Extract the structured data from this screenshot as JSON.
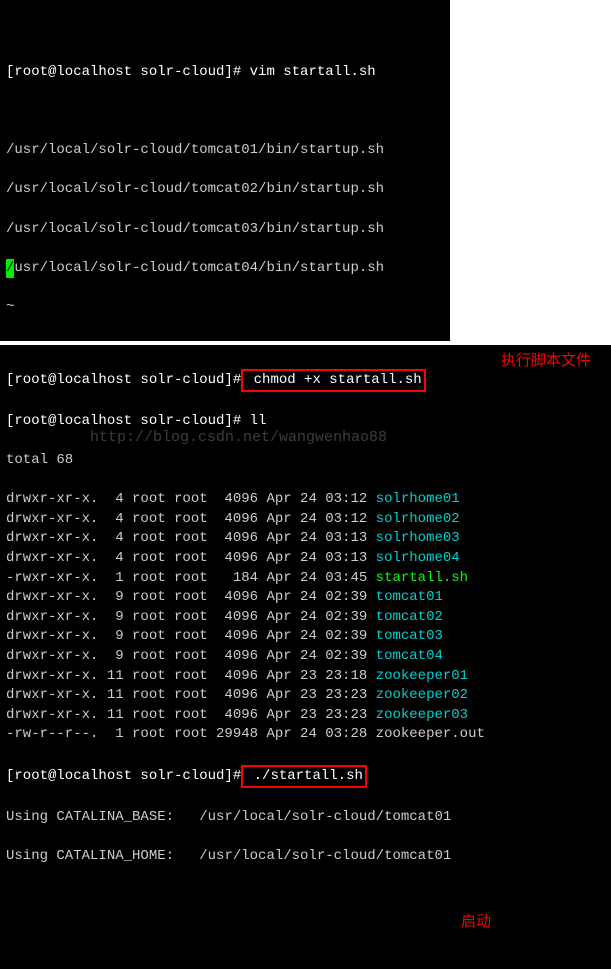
{
  "block1": {
    "line0": "                              ",
    "line1_prompt": "[root@localhost solr-cloud]#",
    "line1_cmd": " vim startall.sh",
    "blank": "",
    "paths": [
      "/usr/local/solr-cloud/tomcat01/bin/startup.sh",
      "/usr/local/solr-cloud/tomcat02/bin/startup.sh",
      "/usr/local/solr-cloud/tomcat03/bin/startup.sh"
    ],
    "path4_lead": "/",
    "path4_rest": "usr/local/solr-cloud/tomcat04/bin/startup.sh",
    "end": "~"
  },
  "block2": {
    "line1_prompt": "[root@localhost solr-cloud]#",
    "line1_cmd": " chmod +x startall.sh",
    "line2_prompt": "[root@localhost solr-cloud]#",
    "line2_cmd": " ll",
    "total": "total 68",
    "files": [
      {
        "perm": "drwxr-xr-x.",
        "n": "  4",
        "o": " root root",
        "sz": "  4096",
        "dt": " Apr 24 03:12 ",
        "name": "solrhome01",
        "cls": "cyan"
      },
      {
        "perm": "drwxr-xr-x.",
        "n": "  4",
        "o": " root root",
        "sz": "  4096",
        "dt": " Apr 24 03:12 ",
        "name": "solrhome02",
        "cls": "cyan"
      },
      {
        "perm": "drwxr-xr-x.",
        "n": "  4",
        "o": " root root",
        "sz": "  4096",
        "dt": " Apr 24 03:13 ",
        "name": "solrhome03",
        "cls": "cyan"
      },
      {
        "perm": "drwxr-xr-x.",
        "n": "  4",
        "o": " root root",
        "sz": "  4096",
        "dt": " Apr 24 03:13 ",
        "name": "solrhome04",
        "cls": "cyan"
      },
      {
        "perm": "-rwxr-xr-x.",
        "n": "  1",
        "o": " root root",
        "sz": "   184",
        "dt": " Apr 24 03:45 ",
        "name": "startall.sh",
        "cls": "green"
      },
      {
        "perm": "drwxr-xr-x.",
        "n": "  9",
        "o": " root root",
        "sz": "  4096",
        "dt": " Apr 24 02:39 ",
        "name": "tomcat01",
        "cls": "cyan"
      },
      {
        "perm": "drwxr-xr-x.",
        "n": "  9",
        "o": " root root",
        "sz": "  4096",
        "dt": " Apr 24 02:39 ",
        "name": "tomcat02",
        "cls": "cyan"
      },
      {
        "perm": "drwxr-xr-x.",
        "n": "  9",
        "o": " root root",
        "sz": "  4096",
        "dt": " Apr 24 02:39 ",
        "name": "tomcat03",
        "cls": "cyan"
      },
      {
        "perm": "drwxr-xr-x.",
        "n": "  9",
        "o": " root root",
        "sz": "  4096",
        "dt": " Apr 24 02:39 ",
        "name": "tomcat04",
        "cls": "cyan"
      },
      {
        "perm": "drwxr-xr-x.",
        "n": " 11",
        "o": " root root",
        "sz": "  4096",
        "dt": " Apr 23 23:18 ",
        "name": "zookeeper01",
        "cls": "cyan"
      },
      {
        "perm": "drwxr-xr-x.",
        "n": " 11",
        "o": " root root",
        "sz": "  4096",
        "dt": " Apr 23 23:23 ",
        "name": "zookeeper02",
        "cls": "cyan"
      },
      {
        "perm": "drwxr-xr-x.",
        "n": " 11",
        "o": " root root",
        "sz": "  4096",
        "dt": " Apr 23 23:23 ",
        "name": "zookeeper03",
        "cls": "cyan"
      },
      {
        "perm": "-rw-r--r--.",
        "n": "  1",
        "o": " root root",
        "sz": " 29948",
        "dt": " Apr 24 03:28 ",
        "name": "zookeeper.out",
        "cls": ""
      }
    ],
    "run_prompt": "[root@localhost solr-cloud]#",
    "run_cmd": " ./startall.sh",
    "cat1_label": "Using CATALINA_BASE:   ",
    "cat1_path": "/usr/local/solr-cloud/tomcat01",
    "cat2_label": "Using CATALINA_HOME:   ",
    "cat2_path": "/usr/local/solr-cloud/tomcat01"
  },
  "annotations": {
    "exec_label": "执行脚本文件",
    "start_label": "启动"
  },
  "watermark": "http://blog.csdn.net/wangwenhao88"
}
